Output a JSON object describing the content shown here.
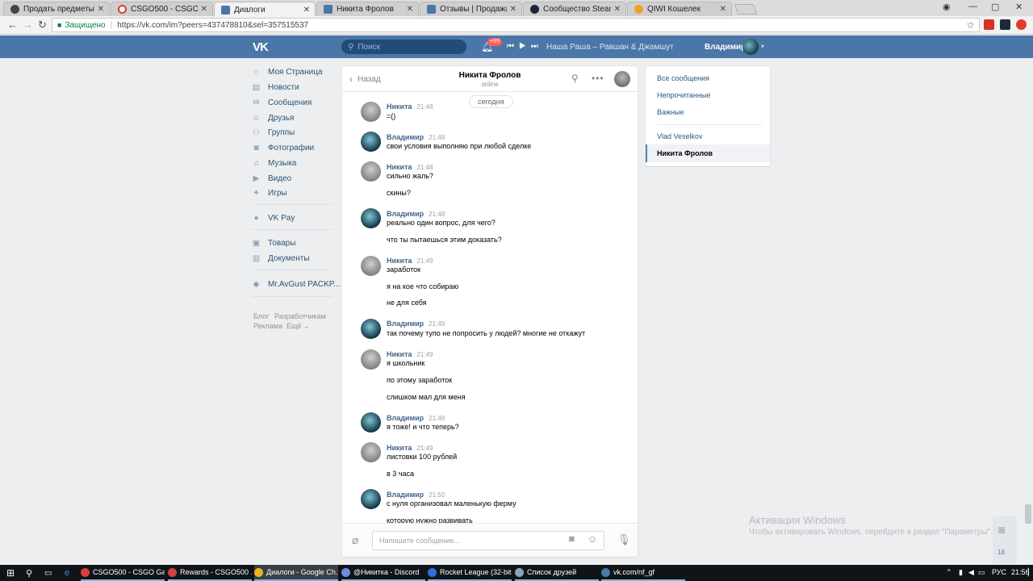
{
  "browser": {
    "tabs": [
      {
        "title": "Продать предметы | Ma",
        "color": "#444444"
      },
      {
        "title": "CSGO500 - CSGO Gambl",
        "color": "#d4403a"
      },
      {
        "title": "Диалоги",
        "color": "#4a76a8"
      },
      {
        "title": "Никита Фролов",
        "color": "#4a76a8"
      },
      {
        "title": "Отзывы | Продажа/Пок",
        "color": "#4a76a8"
      },
      {
        "title": "Сообщество Steam :: Пр",
        "color": "#1b2838"
      },
      {
        "title": "QIWI Кошелек",
        "color": "#f0a12b"
      }
    ],
    "close_glyph": "✕",
    "address": {
      "secure_label": "Защищено",
      "url": "https://vk.com/im?peers=437478810&sel=357515537"
    }
  },
  "vk": {
    "logo": "VK",
    "search_placeholder": "Поиск",
    "notifications_badge": "+99",
    "now_playing": "Наша Раша – Равшан & Джамшут",
    "user_name": "Владимир"
  },
  "menu": {
    "items": [
      {
        "label": "Моя Страница",
        "icon": "home-icon"
      },
      {
        "label": "Новости",
        "icon": "news-icon"
      },
      {
        "label": "Сообщения",
        "icon": "messages-icon"
      },
      {
        "label": "Друзья",
        "icon": "friends-icon"
      },
      {
        "label": "Группы",
        "icon": "groups-icon"
      },
      {
        "label": "Фотографии",
        "icon": "photos-icon"
      },
      {
        "label": "Музыка",
        "icon": "music-icon"
      },
      {
        "label": "Видео",
        "icon": "video-icon"
      },
      {
        "label": "Игры",
        "icon": "games-icon"
      },
      {
        "label": "VK Pay",
        "icon": "vkpay-icon"
      },
      {
        "label": "Товары",
        "icon": "goods-icon"
      },
      {
        "label": "Документы",
        "icon": "documents-icon"
      },
      {
        "label": "Mr.AvGust PACKP...",
        "icon": "app-icon"
      }
    ],
    "footer": [
      "Блог",
      "Разработчикам",
      "Реклама",
      "Ещё ⌄"
    ]
  },
  "dialog": {
    "back_label": "Назад",
    "peer_name": "Никита Фролов",
    "peer_status": "online",
    "date_chip": "сегодня",
    "messages": [
      {
        "author": "Никита",
        "time": "21:48",
        "lines": [
          "=()"
        ]
      },
      {
        "author": "Владимир",
        "time": "21:48",
        "lines": [
          "свои условия выполняю при любой сделке"
        ]
      },
      {
        "author": "Никита",
        "time": "21:48",
        "lines": [
          "сильно жаль?",
          "скины?"
        ]
      },
      {
        "author": "Владимир",
        "time": "21:48",
        "lines": [
          "реально один вопрос, для чего?",
          "что ты пытаешься этим доказать?"
        ]
      },
      {
        "author": "Никита",
        "time": "21:49",
        "lines": [
          "заработок",
          "я на кое что собираю",
          "не для себя"
        ]
      },
      {
        "author": "Владимир",
        "time": "21:49",
        "lines": [
          "так почему тупо не попросить у людей? многие не откажут"
        ]
      },
      {
        "author": "Никита",
        "time": "21:49",
        "lines": [
          "я школьник",
          "по этому заработок",
          "слишком мал для меня"
        ]
      },
      {
        "author": "Владимир",
        "time": "21:49",
        "lines": [
          "я тоже! и что теперь?"
        ]
      },
      {
        "author": "Никита",
        "time": "21:49",
        "lines": [
          "листовки 100 рублей",
          "в 3 часа"
        ]
      },
      {
        "author": "Владимир",
        "time": "21:50",
        "lines": [
          "с нуля организовал маленькую ферму",
          "которую нужно развивать"
        ]
      }
    ],
    "composer_placeholder": "Напишите сообщение..."
  },
  "folders": {
    "items": [
      "Все сообщения",
      "Непрочитанные",
      "Важные"
    ],
    "peers": [
      "Vlad Veselkov",
      "Никита Фролов"
    ]
  },
  "watermark": {
    "title": "Активация Windows",
    "subtitle": "Чтобы активировать Windows, перейдите в раздел \"Параметры\"."
  },
  "floating_counter": "18",
  "taskbar": {
    "items": [
      {
        "label": "CSGO500 - CSGO Ga...",
        "color": "#d4403a"
      },
      {
        "label": "Rewards - CSGO500 ...",
        "color": "#d4403a"
      },
      {
        "label": "Диалоги - Google Ch...",
        "color": "#e8b322"
      },
      {
        "label": "@Никитка - Discord",
        "color": "#7289da"
      },
      {
        "label": "Rocket League (32-bit...",
        "color": "#2f6fd6"
      },
      {
        "label": "Список друзей",
        "color": "#8aa2bb"
      },
      {
        "label": "vk.com/nf_gf",
        "color": "#4a76a8"
      }
    ],
    "lang": "РУС",
    "clock": "21:56"
  }
}
